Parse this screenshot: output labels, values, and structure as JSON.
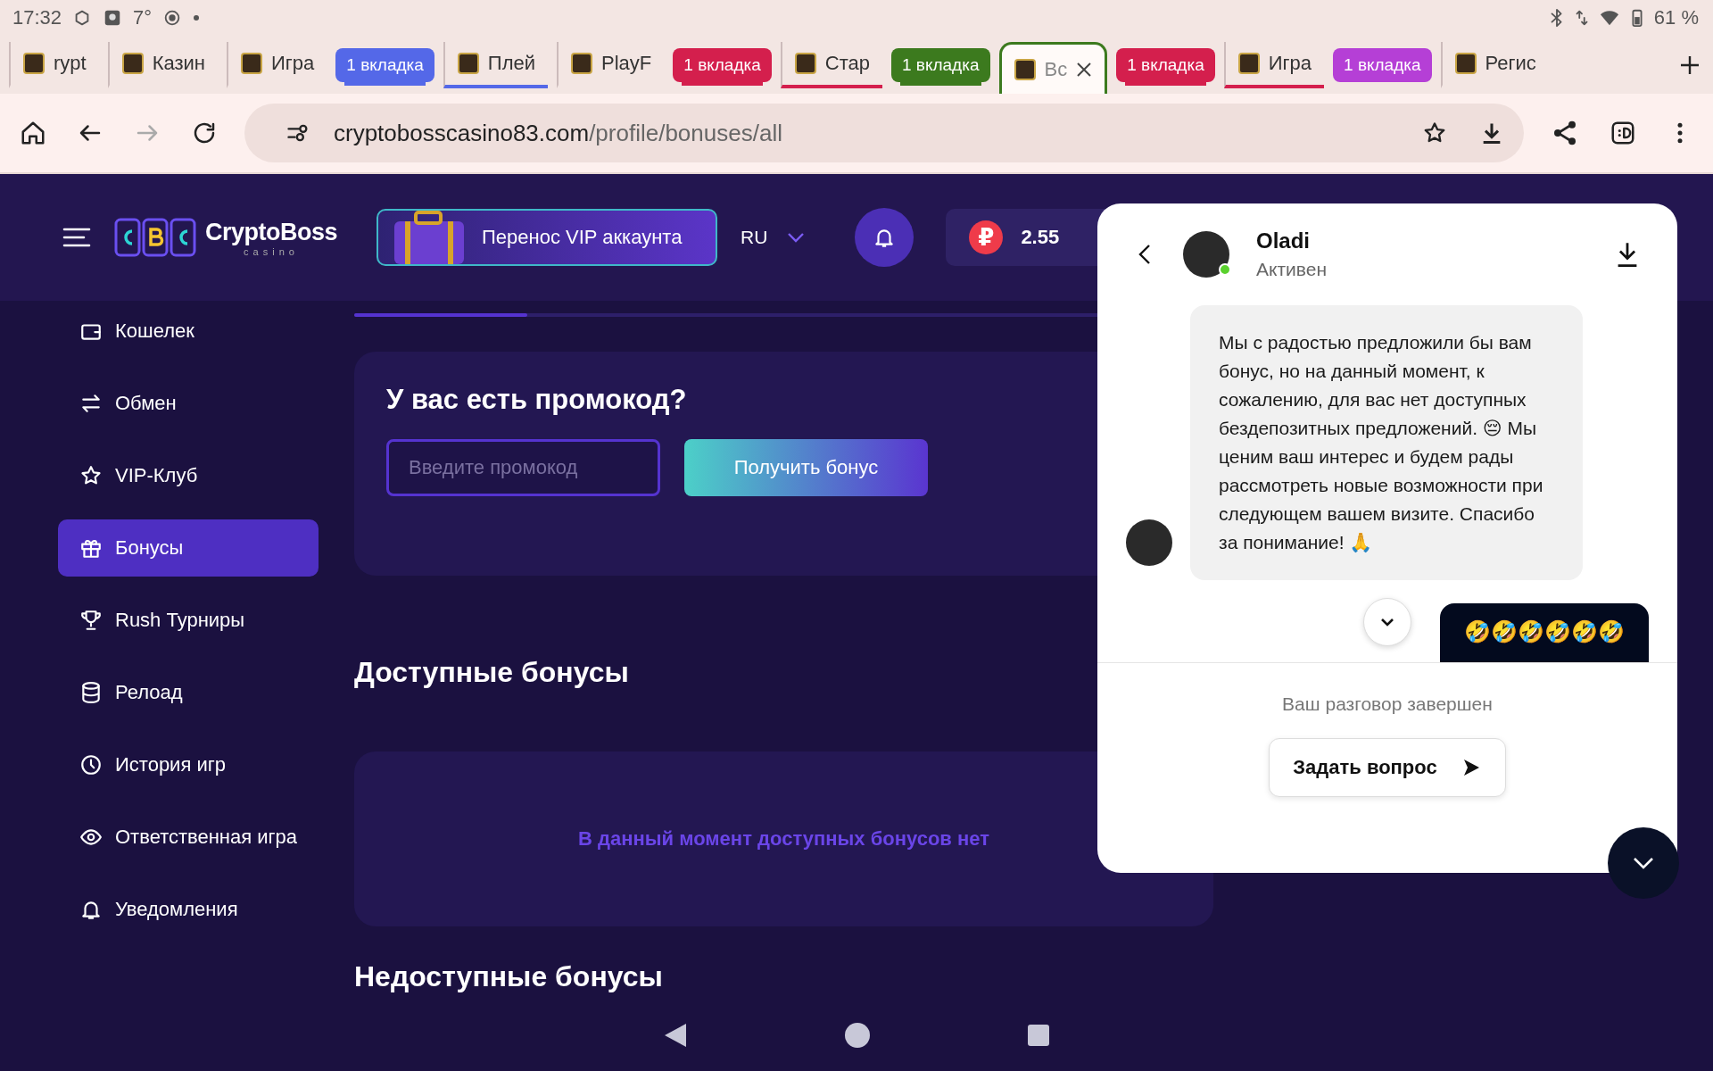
{
  "status_bar": {
    "time": "17:32",
    "temperature": "7°",
    "battery": "61 %"
  },
  "tabs": [
    {
      "kind": "site",
      "title": "rypt",
      "in_group": false,
      "selected": false
    },
    {
      "kind": "site",
      "title": "Казин",
      "in_group": false,
      "selected": false
    },
    {
      "kind": "site",
      "title": "Игра",
      "in_group": false,
      "selected": false
    },
    {
      "kind": "group",
      "title": "1 вкладка",
      "color": "#5468e8"
    },
    {
      "kind": "site",
      "title": "Плей",
      "in_group": true,
      "selected": false
    },
    {
      "kind": "site",
      "title": "PlayF",
      "in_group": false,
      "selected": false
    },
    {
      "kind": "group",
      "title": "1 вкладка",
      "color": "#d41f4d"
    },
    {
      "kind": "site",
      "title": "Стар",
      "in_group": true,
      "selected": false
    },
    {
      "kind": "group",
      "title": "1 вкладка",
      "color": "#3c7a1e"
    },
    {
      "kind": "site",
      "title": "Вс",
      "in_group": true,
      "selected": true
    },
    {
      "kind": "group",
      "title": "1 вкладка",
      "color": "#d41f4d"
    },
    {
      "kind": "site",
      "title": "Игра",
      "in_group": true,
      "selected": false
    },
    {
      "kind": "group",
      "title": "1 вкладка",
      "color": "#b53fd6"
    },
    {
      "kind": "site",
      "title": "Регис",
      "in_group": false,
      "selected": false
    }
  ],
  "address_bar": {
    "host": "cryptobosscasino83.com",
    "path": "/profile/bonuses/all",
    "forward_disabled": true
  },
  "header": {
    "logo_text": "CryptoBoss",
    "logo_subtext": "casino",
    "vip_banner": "Перенос VIP аккаунта",
    "language": "RU",
    "currency_symbol": "₽",
    "balance": "2.55"
  },
  "sidebar": {
    "items": [
      {
        "label": "Кошелек",
        "selected": false
      },
      {
        "label": "Обмен",
        "selected": false
      },
      {
        "label": "VIP-Клуб",
        "selected": false
      },
      {
        "label": "Бонусы",
        "selected": true
      },
      {
        "label": "Rush Турниры",
        "selected": false
      },
      {
        "label": "Релоад",
        "selected": false
      },
      {
        "label": "История игр",
        "selected": false
      },
      {
        "label": "Ответственная игра",
        "selected": false
      },
      {
        "label": "Уведомления",
        "selected": false
      }
    ]
  },
  "promo": {
    "title": "У вас есть промокод?",
    "placeholder": "Введите промокод",
    "button": "Получить бонус"
  },
  "available": {
    "title": "Доступные бонусы",
    "empty_text": "В данный момент доступных бонусов нет"
  },
  "unavailable": {
    "title": "Недоступные бонусы"
  },
  "chat": {
    "agent": {
      "name": "Oladi",
      "status": "Активен",
      "online": true
    },
    "messages": [
      {
        "kind": "agent",
        "text": "Мы с радостью предложили бы вам бонус, но на данный момент, к сожалению, для вас нет доступных бездепозитных предложений. 😔 Мы ценим ваш интерес и будем рады рассмотреть новые возможности при следующем вашем визите. Спасибо за понимание! 🙏"
      },
      {
        "kind": "user",
        "text": "🤣🤣🤣🤣🤣🤣"
      }
    ],
    "closed_notice": "Ваш разговор завершен",
    "action_button": "Задать вопрос"
  }
}
